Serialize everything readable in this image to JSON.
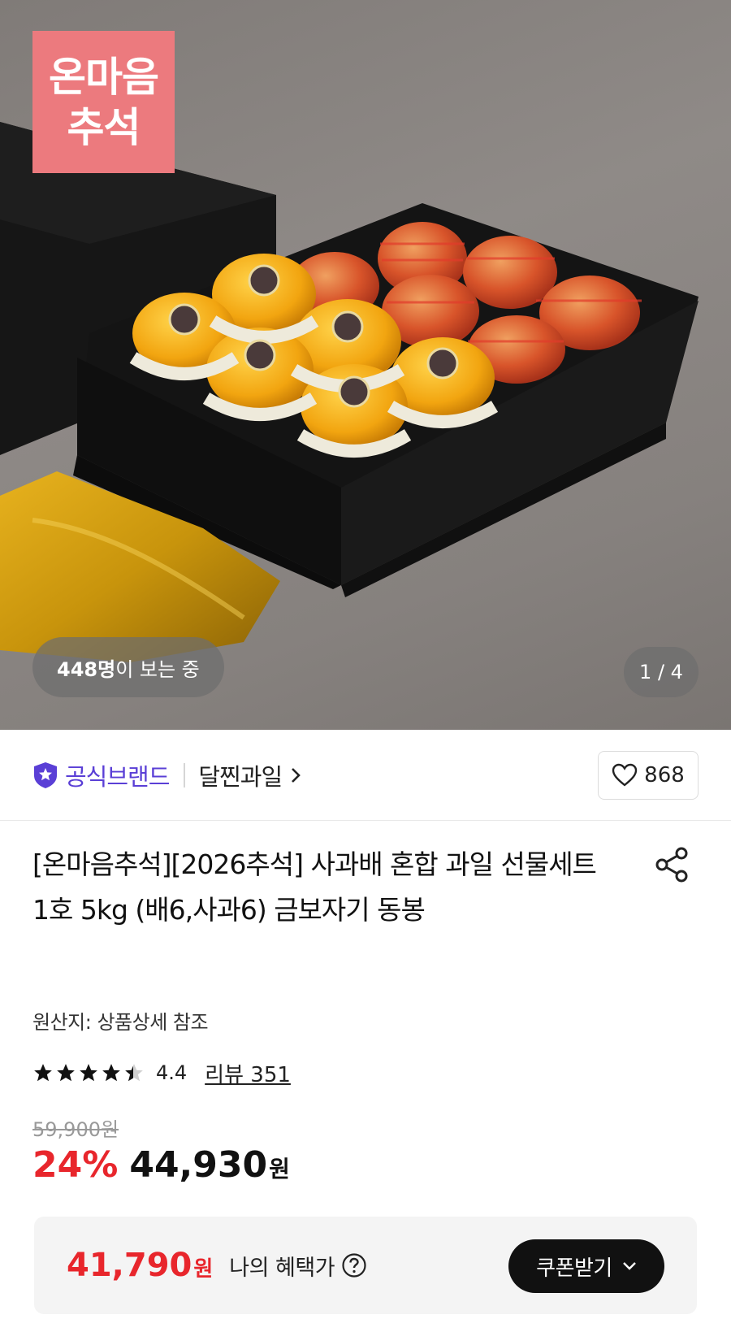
{
  "hero": {
    "promo_badge_line1": "온마음",
    "promo_badge_line2": "추석",
    "viewers_count": "448명",
    "viewers_suffix": "이 보는 중",
    "image_counter": "1 / 4"
  },
  "brand": {
    "official_label": "공식브랜드",
    "store_name": "달찐과일",
    "like_count": "868"
  },
  "product": {
    "title": "[온마음추석][2026추석] 사과배 혼합 과일 선물세트 1호 5kg (배6,사과6) 금보자기 동봉",
    "origin": "원산지: 상품상세 참조",
    "rating": "4.4",
    "rating_value": 4.4,
    "review_link": "리뷰 351",
    "original_price": "59,900원",
    "discount": "24%",
    "sale_price": "44,930",
    "won": "원"
  },
  "benefit": {
    "price": "41,790",
    "won": "원",
    "label": "나의 혜택가",
    "coupon_button": "쿠폰받기"
  },
  "colors": {
    "accent_red": "#e8262c",
    "brand_purple": "#5a3fd6",
    "promo_pink": "#ec7a7e"
  }
}
